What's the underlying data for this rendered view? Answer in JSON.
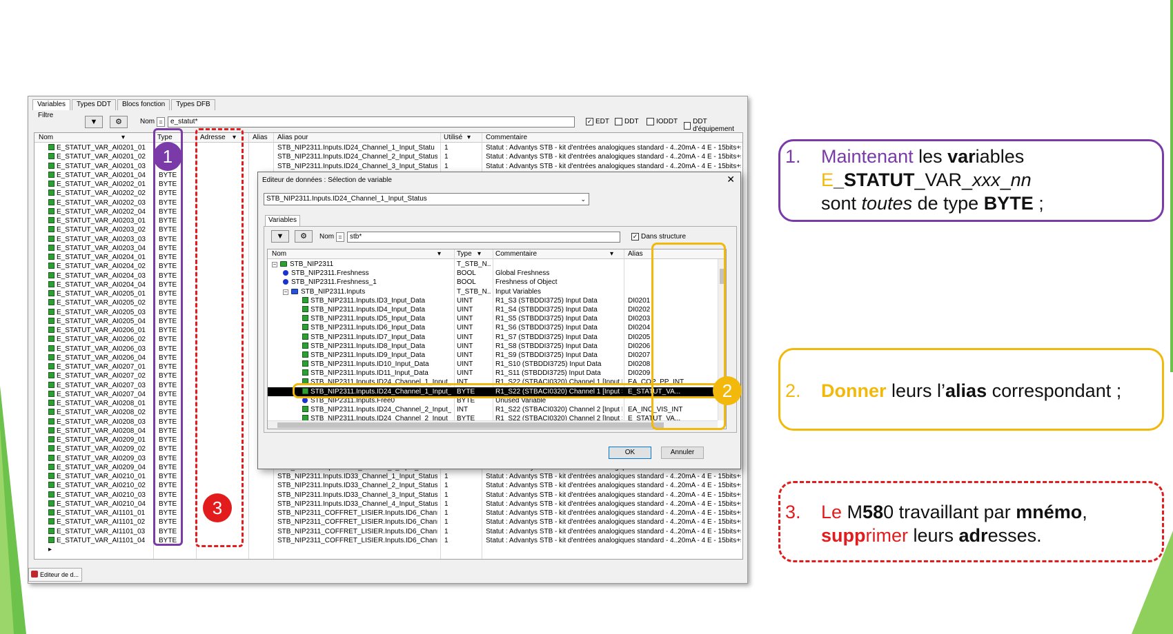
{
  "window": {
    "tabs": [
      "Variables",
      "Types DDT",
      "Blocs fonction",
      "Types DFB"
    ],
    "filter_label": "Filtre",
    "name_label": "Nom",
    "eq": "=",
    "filter_value": "e_statut*",
    "checkboxes": [
      {
        "label": "EDT",
        "checked": true
      },
      {
        "label": "DDT",
        "checked": false
      },
      {
        "label": "IODDT",
        "checked": false
      },
      {
        "label": "DDT d'équipement",
        "checked": false
      }
    ],
    "columns": {
      "nom": "Nom",
      "type": "Type",
      "adresse": "Adresse",
      "alias": "Alias",
      "alias_pour": "Alias pour",
      "utilise": "Utilisé",
      "commentaire": "Commentaire"
    },
    "status_tab": "Editeur de d..."
  },
  "variables": [
    {
      "nom": "E_STATUT_VAR_AI0201_01",
      "type": "BYTE",
      "alias_pour": "STB_NIP2311.Inputs.ID24_Channel_1_Input_Statu",
      "utilise": "1",
      "commentaire": "Statut : Advantys STB - kit d'entrées analogiques standard - 4..20mA - 4 E - 15bits+signe"
    },
    {
      "nom": "E_STATUT_VAR_AI0201_02",
      "type": "BYTE",
      "alias_pour": "STB_NIP2311.Inputs.ID24_Channel_2_Input_Status",
      "utilise": "1",
      "commentaire": "Statut : Advantys STB - kit d'entrées analogiques standard - 4..20mA - 4 E - 15bits+signe"
    },
    {
      "nom": "E_STATUT_VAR_AI0201_03",
      "type": "BYTE",
      "alias_pour": "STB_NIP2311.Inputs.ID24_Channel_3_Input_Status",
      "utilise": "1",
      "commentaire": "Statut : Advantys STB - kit d'entrées analogiques standard - 4..20mA - 4 E - 15bits+signe"
    },
    {
      "nom": "E_STATUT_VAR_AI0201_04",
      "type": "BYTE"
    },
    {
      "nom": "E_STATUT_VAR_AI0202_01",
      "type": "BYTE"
    },
    {
      "nom": "E_STATUT_VAR_AI0202_02",
      "type": "BYTE"
    },
    {
      "nom": "E_STATUT_VAR_AI0202_03",
      "type": "BYTE"
    },
    {
      "nom": "E_STATUT_VAR_AI0202_04",
      "type": "BYTE"
    },
    {
      "nom": "E_STATUT_VAR_AI0203_01",
      "type": "BYTE"
    },
    {
      "nom": "E_STATUT_VAR_AI0203_02",
      "type": "BYTE"
    },
    {
      "nom": "E_STATUT_VAR_AI0203_03",
      "type": "BYTE"
    },
    {
      "nom": "E_STATUT_VAR_AI0203_04",
      "type": "BYTE"
    },
    {
      "nom": "E_STATUT_VAR_AI0204_01",
      "type": "BYTE"
    },
    {
      "nom": "E_STATUT_VAR_AI0204_02",
      "type": "BYTE"
    },
    {
      "nom": "E_STATUT_VAR_AI0204_03",
      "type": "BYTE"
    },
    {
      "nom": "E_STATUT_VAR_AI0204_04",
      "type": "BYTE"
    },
    {
      "nom": "E_STATUT_VAR_AI0205_01",
      "type": "BYTE"
    },
    {
      "nom": "E_STATUT_VAR_AI0205_02",
      "type": "BYTE"
    },
    {
      "nom": "E_STATUT_VAR_AI0205_03",
      "type": "BYTE"
    },
    {
      "nom": "E_STATUT_VAR_AI0205_04",
      "type": "BYTE"
    },
    {
      "nom": "E_STATUT_VAR_AI0206_01",
      "type": "BYTE"
    },
    {
      "nom": "E_STATUT_VAR_AI0206_02",
      "type": "BYTE"
    },
    {
      "nom": "E_STATUT_VAR_AI0206_03",
      "type": "BYTE"
    },
    {
      "nom": "E_STATUT_VAR_AI0206_04",
      "type": "BYTE"
    },
    {
      "nom": "E_STATUT_VAR_AI0207_01",
      "type": "BYTE"
    },
    {
      "nom": "E_STATUT_VAR_AI0207_02",
      "type": "BYTE"
    },
    {
      "nom": "E_STATUT_VAR_AI0207_03",
      "type": "BYTE"
    },
    {
      "nom": "E_STATUT_VAR_AI0207_04",
      "type": "BYTE"
    },
    {
      "nom": "E_STATUT_VAR_AI0208_01",
      "type": "BYTE"
    },
    {
      "nom": "E_STATUT_VAR_AI0208_02",
      "type": "BYTE"
    },
    {
      "nom": "E_STATUT_VAR_AI0208_03",
      "type": "BYTE"
    },
    {
      "nom": "E_STATUT_VAR_AI0208_04",
      "type": "BYTE"
    },
    {
      "nom": "E_STATUT_VAR_AI0209_01",
      "type": "BYTE"
    },
    {
      "nom": "E_STATUT_VAR_AI0209_02",
      "type": "BYTE"
    },
    {
      "nom": "E_STATUT_VAR_AI0209_03",
      "type": "BYTE"
    },
    {
      "nom": "E_STATUT_VAR_AI0209_04",
      "type": "BYTE",
      "alias_pour": "STB_NIP2311.Inputs.ID32_Channel_4_Input_Status",
      "utilise": "1",
      "commentaire": "Statut : Advantys STB - kit d'entrées analogiques standard - 4..20mA - 4 E - 15bits+signe"
    },
    {
      "nom": "E_STATUT_VAR_AI0210_01",
      "type": "BYTE",
      "alias_pour": "STB_NIP2311.Inputs.ID33_Channel_1_Input_Status",
      "utilise": "1",
      "commentaire": "Statut : Advantys STB - kit d'entrées analogiques standard - 4..20mA - 4 E - 15bits+signe"
    },
    {
      "nom": "E_STATUT_VAR_AI0210_02",
      "type": "BYTE",
      "alias_pour": "STB_NIP2311.Inputs.ID33_Channel_2_Input_Status",
      "utilise": "1",
      "commentaire": "Statut : Advantys STB - kit d'entrées analogiques standard - 4..20mA - 4 E - 15bits+signe"
    },
    {
      "nom": "E_STATUT_VAR_AI0210_03",
      "type": "BYTE",
      "alias_pour": "STB_NIP2311.Inputs.ID33_Channel_3_Input_Status",
      "utilise": "1",
      "commentaire": "Statut : Advantys STB - kit d'entrées analogiques standard - 4..20mA - 4 E - 15bits+signe"
    },
    {
      "nom": "E_STATUT_VAR_AI0210_04",
      "type": "BYTE",
      "alias_pour": "STB_NIP2311.Inputs.ID33_Channel_4_Input_Status",
      "utilise": "1",
      "commentaire": "Statut : Advantys STB - kit d'entrées analogiques standard - 4..20mA - 4 E - 15bits+signe"
    },
    {
      "nom": "E_STATUT_VAR_AI1101_01",
      "type": "BYTE",
      "alias_pour": "STB_NIP2311_COFFRET_LISIER.Inputs.ID6_Channel_...",
      "utilise": "1",
      "commentaire": "Statut : Advantys STB - kit d'entrées analogiques standard - 4..20mA - 4 E - 15bits+signe"
    },
    {
      "nom": "E_STATUT_VAR_AI1101_02",
      "type": "BYTE",
      "alias_pour": "STB_NIP2311_COFFRET_LISIER.Inputs.ID6_Channel_...",
      "utilise": "1",
      "commentaire": "Statut : Advantys STB - kit d'entrées analogiques standard - 4..20mA - 4 E - 15bits+signe"
    },
    {
      "nom": "E_STATUT_VAR_AI1101_03",
      "type": "BYTE",
      "alias_pour": "STB_NIP2311_COFFRET_LISIER.Inputs.ID6_Channel_...",
      "utilise": "1",
      "commentaire": "Statut : Advantys STB - kit d'entrées analogiques standard - 4..20mA - 4 E - 15bits+signe"
    },
    {
      "nom": "E_STATUT_VAR_AI1101_04",
      "type": "BYTE",
      "alias_pour": "STB_NIP2311_COFFRET_LISIER.Inputs.ID6_Channel_...",
      "utilise": "1",
      "commentaire": "Statut : Advantys STB - kit d'entrées analogiques standard - 4..20mA - 4 E - 15bits+signe"
    }
  ],
  "dialog": {
    "title": "Editeur de données : Sélection de variable",
    "combo_value": "STB_NIP2311.Inputs.ID24_Channel_1_Input_Status",
    "tab": "Variables",
    "name_label": "Nom",
    "eq": "=",
    "filter_value": "stb*",
    "dans_structure": "Dans structure",
    "columns": {
      "nom": "Nom",
      "type": "Type",
      "commentaire": "Commentaire",
      "alias": "Alias"
    },
    "rows": [
      {
        "level": 0,
        "icon": "folder",
        "exp": "−",
        "nom": "STB_NIP2311",
        "type": "T_STB_N...",
        "commentaire": "",
        "alias": ""
      },
      {
        "level": 1,
        "icon": "bullet",
        "nom": "STB_NIP2311.Freshness",
        "type": "BOOL",
        "commentaire": "Global Freshness",
        "alias": ""
      },
      {
        "level": 1,
        "icon": "bullet",
        "nom": "STB_NIP2311.Freshness_1",
        "type": "BOOL",
        "commentaire": "Freshness of Object",
        "alias": ""
      },
      {
        "level": 1,
        "icon": "folderb",
        "exp": "−",
        "nom": "STB_NIP2311.Inputs",
        "type": "T_STB_N...",
        "commentaire": "Input Variables",
        "alias": ""
      },
      {
        "level": 2,
        "icon": "var",
        "nom": "STB_NIP2311.Inputs.ID3_Input_Data",
        "type": "UINT",
        "commentaire": "R1_S3 (STBDDI3725) Input Data",
        "alias": "DI0201"
      },
      {
        "level": 2,
        "icon": "var",
        "nom": "STB_NIP2311.Inputs.ID4_Input_Data",
        "type": "UINT",
        "commentaire": "R1_S4 (STBDDI3725) Input Data",
        "alias": "DI0202"
      },
      {
        "level": 2,
        "icon": "var",
        "nom": "STB_NIP2311.Inputs.ID5_Input_Data",
        "type": "UINT",
        "commentaire": "R1_S5 (STBDDI3725) Input Data",
        "alias": "DI0203"
      },
      {
        "level": 2,
        "icon": "var",
        "nom": "STB_NIP2311.Inputs.ID6_Input_Data",
        "type": "UINT",
        "commentaire": "R1_S6 (STBDDI3725) Input Data",
        "alias": "DI0204"
      },
      {
        "level": 2,
        "icon": "var",
        "nom": "STB_NIP2311.Inputs.ID7_Input_Data",
        "type": "UINT",
        "commentaire": "R1_S7 (STBDDI3725) Input Data",
        "alias": "DI0205"
      },
      {
        "level": 2,
        "icon": "var",
        "nom": "STB_NIP2311.Inputs.ID8_Input_Data",
        "type": "UINT",
        "commentaire": "R1_S8 (STBDDI3725) Input Data",
        "alias": "DI0206"
      },
      {
        "level": 2,
        "icon": "var",
        "nom": "STB_NIP2311.Inputs.ID9_Input_Data",
        "type": "UINT",
        "commentaire": "R1_S9 (STBDDI3725) Input Data",
        "alias": "DI0207"
      },
      {
        "level": 2,
        "icon": "var",
        "nom": "STB_NIP2311.Inputs.ID10_Input_Data",
        "type": "UINT",
        "commentaire": "R1_S10 (STBDDI3725) Input Data",
        "alias": "DI0208"
      },
      {
        "level": 2,
        "icon": "var",
        "nom": "STB_NIP2311.Inputs.ID11_Input_Data",
        "type": "UINT",
        "commentaire": "R1_S11 (STBDDI3725) Input Data",
        "alias": "DI0209"
      },
      {
        "level": 2,
        "icon": "var",
        "nom": "STB_NIP2311.Inputs.ID24_Channel_1_Input_Data",
        "type": "INT",
        "commentaire": "R1_S22 (STBACI0320) Channel 1 [Input Data]",
        "alias": "EA_COP_PP_INT"
      },
      {
        "level": 2,
        "icon": "var",
        "selected": true,
        "nom": "STB_NIP2311.Inputs.ID24_Channel_1_Input_Status",
        "type": "BYTE",
        "commentaire": "R1_S22 (STBACI0320) Channel 1 [Input Status]",
        "alias": "E_STATUT_VA..."
      },
      {
        "level": 2,
        "icon": "bullet",
        "nom": "STB_NIP2311.Inputs.Free0",
        "type": "BYTE",
        "commentaire": "Unused Variable",
        "alias": ""
      },
      {
        "level": 2,
        "icon": "var",
        "nom": "STB_NIP2311.Inputs.ID24_Channel_2_Input_Data",
        "type": "INT",
        "commentaire": "R1_S22 (STBACI0320) Channel 2 [Input Data]",
        "alias": "EA_INC_VIS_INT"
      },
      {
        "level": 2,
        "icon": "var",
        "nom": "STB_NIP2311.Inputs.ID24_Channel_2_Input_Status",
        "type": "BYTE",
        "commentaire": "R1_S22 (STBACI0320) Channel 2 [Input Status]",
        "alias": "E_STATUT_VA..."
      }
    ],
    "ok": "OK",
    "cancel": "Annuler"
  },
  "badges": [
    "1",
    "2",
    "3"
  ],
  "notes": [
    {
      "num": "1.",
      "l1a": "Maintenant",
      "l1b": " les ",
      "l1c": "var",
      "l1d": "iables",
      "l2a": "E",
      "l2b": "_STATUT",
      "l2c": "_VAR_",
      "l2d": "xxx",
      "l2e": "_",
      "l2f": "nn",
      "l3a": "sont ",
      "l3b": "toutes",
      "l3c": " de type ",
      "l3d": "BYTE",
      "l3e": " ;"
    },
    {
      "num": "2.",
      "a": "Donner",
      "b": " leurs l’",
      "c": "alias",
      "d": " correspondant ;"
    },
    {
      "num": "3.",
      "l1a": "Le",
      "l1b": " M",
      "l1c": "58",
      "l1d": "0 travaillant par ",
      "l1e": "mnémo",
      "l1f": ",",
      "l2a": "supp",
      "l2b": "rimer",
      "l2c": " leurs ",
      "l2d": "adr",
      "l2e": "esses."
    }
  ],
  "colors": {
    "purple": "#7a3aa8",
    "yellow": "#f2b90c",
    "red": "#e21c1c",
    "green": "#6cc24a"
  }
}
